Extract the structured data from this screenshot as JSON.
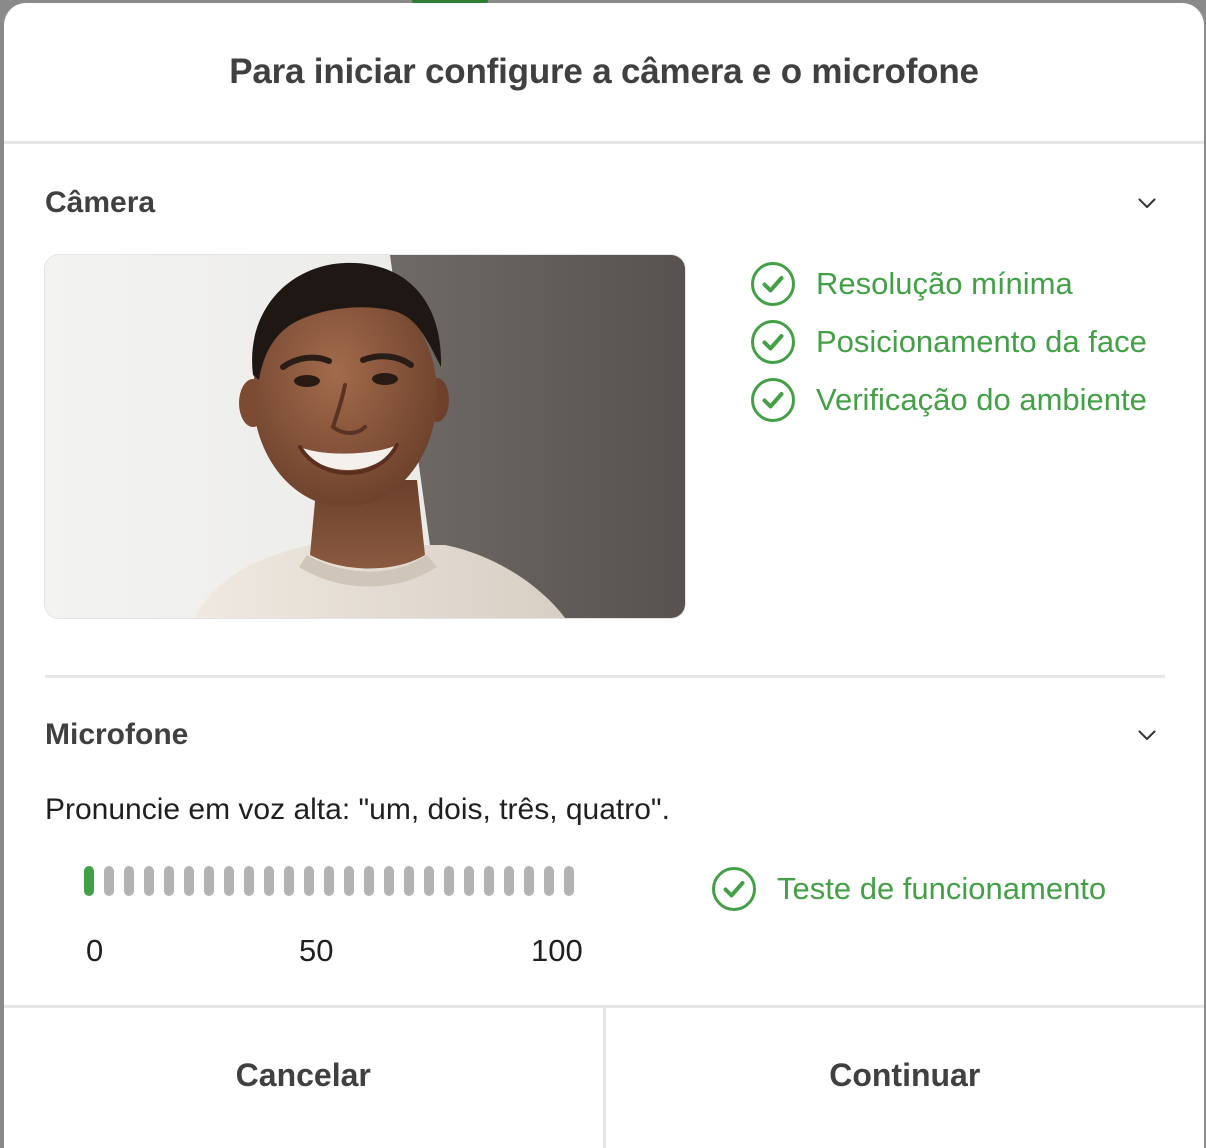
{
  "modal": {
    "title": "Para iniciar configure a câmera e o microfone"
  },
  "camera": {
    "title": "Câmera",
    "preview_image": "person-smiling-portrait",
    "checks": [
      {
        "label": "Resolução mínima",
        "status": "passed"
      },
      {
        "label": "Posicionamento da face",
        "status": "passed"
      },
      {
        "label": "Verificação do ambiente",
        "status": "passed"
      }
    ]
  },
  "microphone": {
    "title": "Microfone",
    "instruction": "Pronuncie em voz alta: \"um, dois, três, quatro\".",
    "level_meter": {
      "segments": 25,
      "active_segments": 1,
      "scale_labels": [
        "0",
        "50",
        "100"
      ]
    },
    "check": {
      "label": "Teste de funcionamento",
      "status": "passed"
    }
  },
  "footer": {
    "cancel_label": "Cancelar",
    "continue_label": "Continuar"
  },
  "colors": {
    "success": "#43a047",
    "text_primary": "#404040",
    "divider": "#e6e6e6",
    "meter_inactive": "#b3b3b3"
  },
  "icons": {
    "section_toggle": "chevron-down-icon",
    "check": "check-circle-icon"
  }
}
